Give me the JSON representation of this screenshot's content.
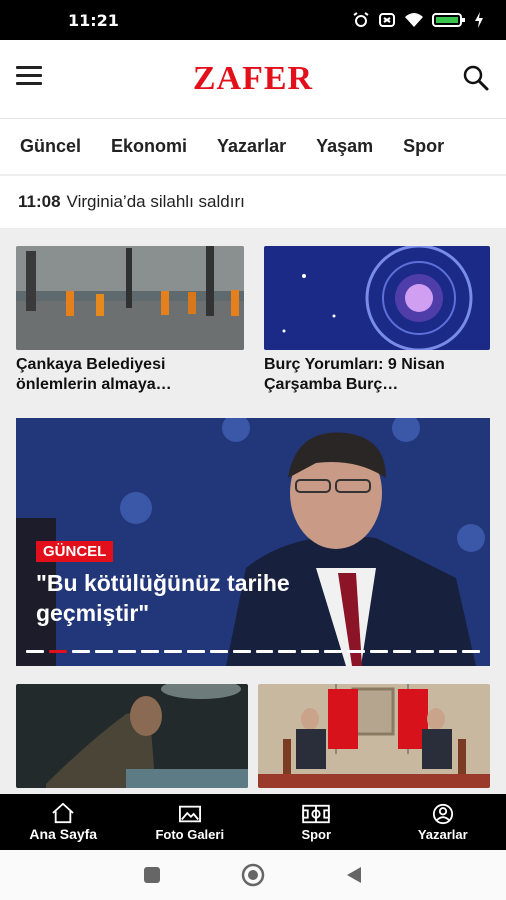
{
  "status_bar": {
    "time": "11:21"
  },
  "header": {
    "logo": "ZAFER"
  },
  "tabs": [
    "Güncel",
    "Ekonomi",
    "Yazarlar",
    "Yaşam",
    "Spor"
  ],
  "ticker": {
    "time": "11:08",
    "text": "Virginia’da silahlı saldırı"
  },
  "cards": [
    {
      "title": "Çankaya Belediyesi önlemlerin almaya…"
    },
    {
      "title": "Burç Yorumları: 9 Nisan Çarşamba Burç…"
    }
  ],
  "hero": {
    "badge": "GÜNCEL",
    "title": "\"Bu kötülüğünüz tarihe geçmiştir\"",
    "slide_count": 20,
    "active_slide": 2
  },
  "bottom_nav": [
    {
      "label": "Ana Sayfa",
      "icon": "home-icon"
    },
    {
      "label": "Foto Galeri",
      "icon": "photo-gallery-icon"
    },
    {
      "label": "Spor",
      "icon": "sports-field-icon"
    },
    {
      "label": "Yazarlar",
      "icon": "author-icon"
    }
  ],
  "colors": {
    "brand": "#e3101b",
    "nav_bg": "#000000"
  }
}
